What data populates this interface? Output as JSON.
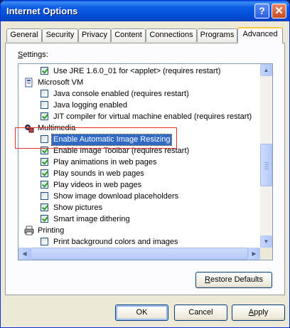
{
  "window": {
    "title": "Internet Options",
    "help_glyph": "?",
    "close_glyph": "✕"
  },
  "tabs": [
    "General",
    "Security",
    "Privacy",
    "Content",
    "Connections",
    "Programs",
    "Advanced"
  ],
  "active_tab": "Advanced",
  "settings_label": {
    "accel": "S",
    "rest": "ettings:"
  },
  "list": {
    "items": [
      {
        "type": "checkbox",
        "checked": true,
        "label": "Use JRE 1.6.0_01 for <applet> (requires restart)"
      },
      {
        "type": "category",
        "icon": "microsoft-vm-icon",
        "label": "Microsoft VM"
      },
      {
        "type": "checkbox",
        "checked": false,
        "label": "Java console enabled (requires restart)"
      },
      {
        "type": "checkbox",
        "checked": false,
        "label": "Java logging enabled"
      },
      {
        "type": "checkbox",
        "checked": true,
        "label": "JIT compiler for virtual machine enabled (requires restart)"
      },
      {
        "type": "category",
        "icon": "multimedia-icon",
        "label": "Multimedia"
      },
      {
        "type": "checkbox",
        "checked": false,
        "label": "Enable Automatic Image Resizing",
        "selected": true
      },
      {
        "type": "checkbox",
        "checked": true,
        "label": "Enable Image Toolbar (requires restart)"
      },
      {
        "type": "checkbox",
        "checked": true,
        "label": "Play animations in web pages"
      },
      {
        "type": "checkbox",
        "checked": true,
        "label": "Play sounds in web pages"
      },
      {
        "type": "checkbox",
        "checked": true,
        "label": "Play videos in web pages"
      },
      {
        "type": "checkbox",
        "checked": false,
        "label": "Show image download placeholders"
      },
      {
        "type": "checkbox",
        "checked": true,
        "label": "Show pictures"
      },
      {
        "type": "checkbox",
        "checked": true,
        "label": "Smart image dithering"
      },
      {
        "type": "category",
        "icon": "printer-icon",
        "label": "Printing"
      },
      {
        "type": "checkbox",
        "checked": false,
        "label": "Print background colors and images"
      }
    ]
  },
  "scroll": {
    "up": "▲",
    "down": "▼",
    "left": "◀",
    "right": "▶"
  },
  "buttons": {
    "restore_defaults": {
      "accel": "R",
      "rest": "estore Defaults"
    },
    "ok": "OK",
    "cancel": "Cancel",
    "apply": {
      "accel": "A",
      "rest": "pply"
    }
  },
  "colors": {
    "highlight": "#316ac5",
    "annotation_box": "#e03030",
    "title_bar": "#0250d8"
  }
}
